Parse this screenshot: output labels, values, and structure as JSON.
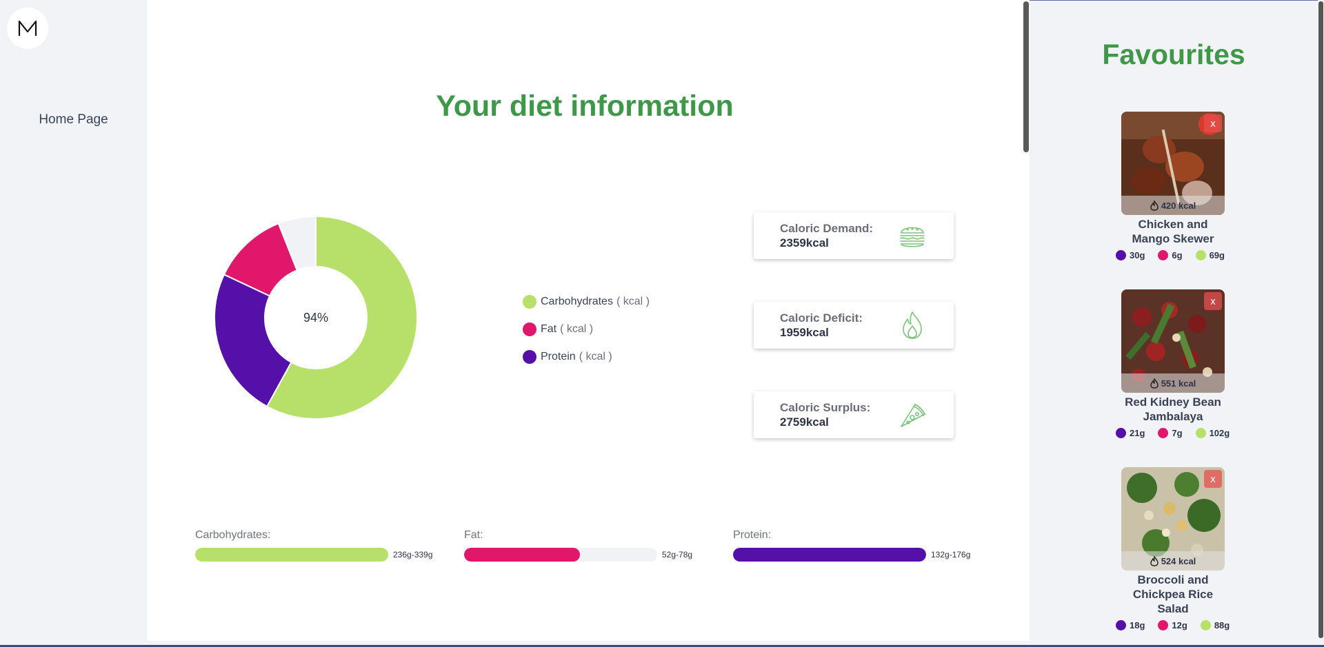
{
  "sidebar": {
    "logo_letter": "M",
    "nav": {
      "home": "Home Page"
    }
  },
  "main": {
    "title": "Your diet information",
    "legend": [
      {
        "label": "Carbohydrates",
        "unit": "( kcal )",
        "color": "#b7e06a"
      },
      {
        "label": "Fat",
        "unit": "( kcal )",
        "color": "#e0176a"
      },
      {
        "label": "Protein",
        "unit": "( kcal )",
        "color": "#5410a8"
      }
    ],
    "cards": [
      {
        "label": "Caloric Demand:",
        "value": "2359kcal",
        "icon": "burger-icon"
      },
      {
        "label": "Caloric Deficit:",
        "value": "1959kcal",
        "icon": "flame-icon"
      },
      {
        "label": "Caloric Surplus:",
        "value": "2759kcal",
        "icon": "pizza-icon"
      }
    ],
    "macros": [
      {
        "label": "Carbohydrates:",
        "range": "236g-339g",
        "fill": 1.0,
        "color": "#b7e06a"
      },
      {
        "label": "Fat:",
        "range": "52g-78g",
        "fill": 0.6,
        "color": "#e0176a"
      },
      {
        "label": "Protein:",
        "range": "132g-176g",
        "fill": 1.0,
        "color": "#5410a8"
      }
    ]
  },
  "chart_data": {
    "type": "pie",
    "center_label": "94%",
    "series": [
      {
        "name": "Carbohydrates",
        "value": 58,
        "color": "#b7e06a"
      },
      {
        "name": "Protein",
        "value": 24,
        "color": "#5410a8"
      },
      {
        "name": "Fat",
        "value": 12,
        "color": "#e0176a"
      },
      {
        "name": "",
        "value": 6,
        "color": "#f1f2f5"
      }
    ]
  },
  "favourites": {
    "title": "Favourites",
    "close_label": "x",
    "items": [
      {
        "name_lines": [
          "Chicken and",
          "Mango Skewer"
        ],
        "kcal": "420 kcal",
        "protein": "30g",
        "fat": "6g",
        "carbs": "69g"
      },
      {
        "name_lines": [
          "Red Kidney Bean",
          "Jambalaya"
        ],
        "kcal": "551 kcal",
        "protein": "21g",
        "fat": "7g",
        "carbs": "102g"
      },
      {
        "name_lines": [
          "Broccoli and",
          "Chickpea Rice",
          "Salad"
        ],
        "kcal": "524 kcal",
        "protein": "18g",
        "fat": "12g",
        "carbs": "88g"
      }
    ]
  }
}
